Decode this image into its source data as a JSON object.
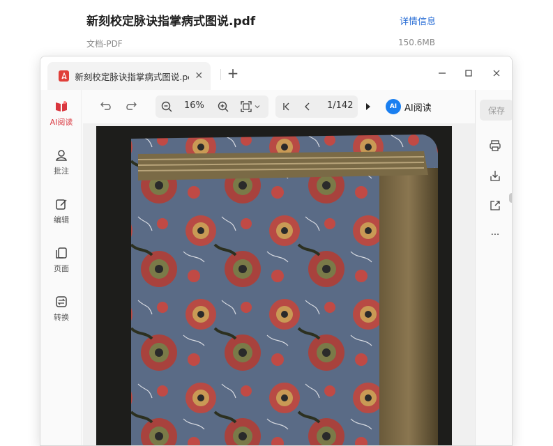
{
  "file": {
    "title": "新刻校定脉诀指掌病式图说.pdf",
    "detail_link": "详情信息",
    "type": "文档-PDF",
    "size": "150.6MB"
  },
  "tab": {
    "title": "新刻校定脉诀指掌病式图说.pdf",
    "close_glyph": "✕",
    "new_glyph": "+"
  },
  "window_controls": {
    "minimize": "—",
    "maximize": "☐",
    "close": "✕"
  },
  "left_rail": [
    {
      "label": "AI阅读",
      "icon": "ai-read-icon"
    },
    {
      "label": "批注",
      "icon": "annotate-icon"
    },
    {
      "label": "编辑",
      "icon": "edit-icon"
    },
    {
      "label": "页面",
      "icon": "pages-icon"
    },
    {
      "label": "转换",
      "icon": "convert-icon"
    }
  ],
  "toolbar": {
    "zoom": "16%",
    "page": "1/142",
    "ai_read": "AI阅读",
    "ai_logo": "AI",
    "more": "···"
  },
  "right_rail": {
    "save": "保存",
    "more": "···"
  },
  "colors": {
    "accent_red": "#d9363e",
    "link_blue": "#2b6fd6",
    "ai_blue": "#1a7ff0"
  }
}
